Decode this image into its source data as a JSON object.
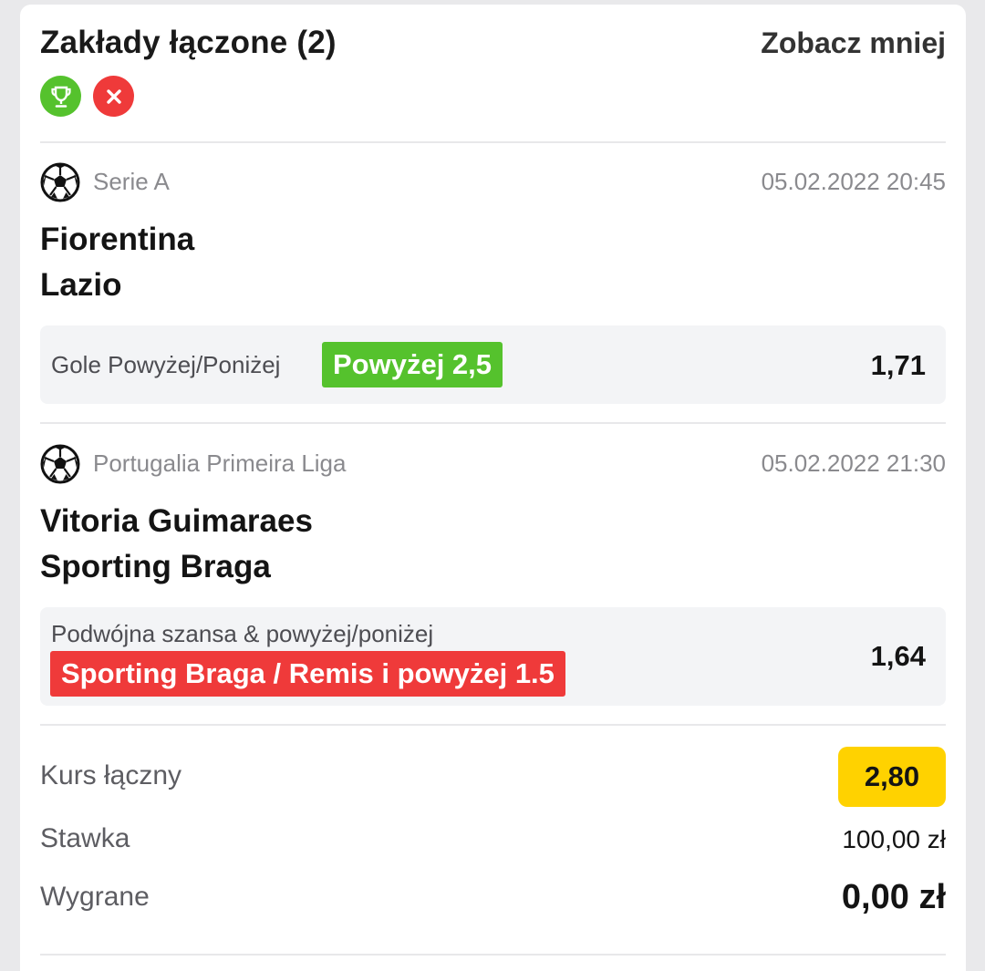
{
  "header": {
    "title": "Zakłady łączone (2)",
    "toggle_label": "Zobacz mniej",
    "status_icons": [
      "trophy-icon",
      "close-icon"
    ]
  },
  "events": [
    {
      "sport_icon": "soccer-ball-icon",
      "league": "Serie A",
      "datetime": "05.02.2022 20:45",
      "home": "Fiorentina",
      "away": "Lazio",
      "market": "Gole Powyżej/Poniżej",
      "selection": "Powyżej 2,5",
      "selection_status": "won",
      "odds": "1,71"
    },
    {
      "sport_icon": "soccer-ball-icon",
      "league": "Portugalia Primeira Liga",
      "datetime": "05.02.2022 21:30",
      "home": "Vitoria Guimaraes",
      "away": "Sporting Braga",
      "market": "Podwójna szansa & powyżej/poniżej",
      "selection": "Sporting Braga / Remis i powyżej 1.5",
      "selection_status": "lost",
      "odds": "1,64"
    }
  ],
  "summary": {
    "total_odds_label": "Kurs łączny",
    "total_odds": "2,80",
    "stake_label": "Stawka",
    "stake": "100,00 zł",
    "winnings_label": "Wygrane",
    "winnings": "0,00 zł"
  },
  "colors": {
    "win_green": "#55c22d",
    "lose_red": "#ef3a3a",
    "odds_yellow": "#ffd200"
  }
}
